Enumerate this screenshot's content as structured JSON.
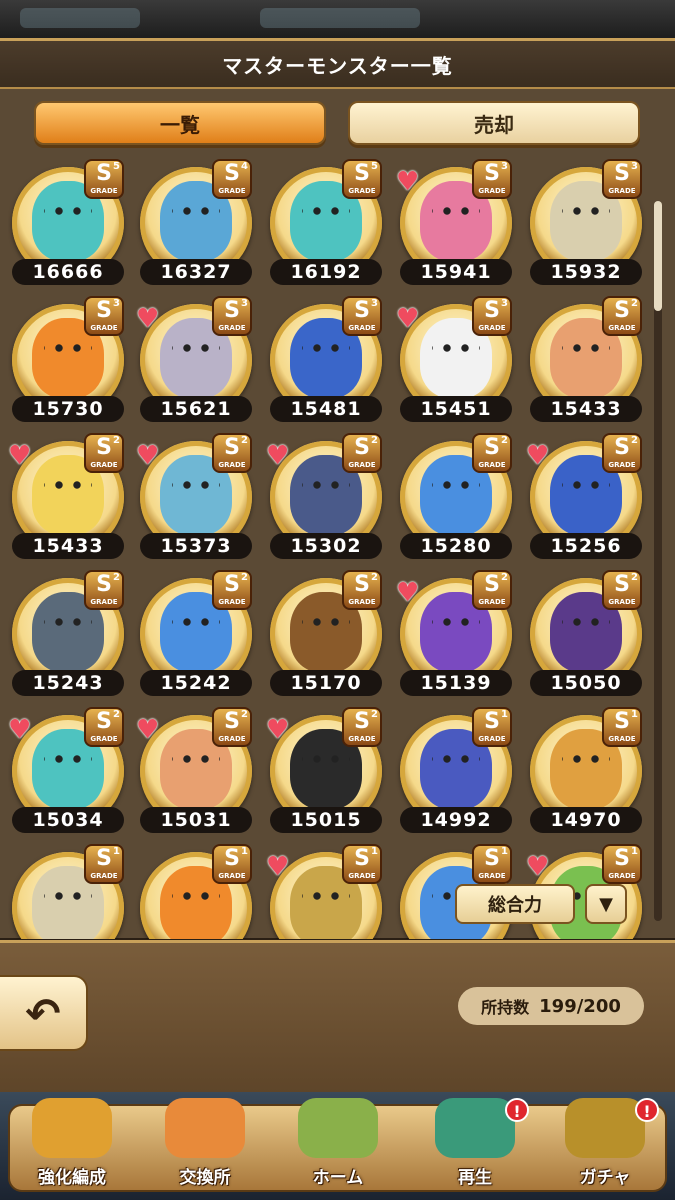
{
  "header": {
    "title": "マスターモンスター一覧"
  },
  "tabs": [
    {
      "label": "一覧",
      "active": true
    },
    {
      "label": "売却",
      "active": false
    }
  ],
  "monsters": [
    {
      "power": "16666",
      "grade": "5",
      "heart": false,
      "color": "#4ec3c0"
    },
    {
      "power": "16327",
      "grade": "4",
      "heart": false,
      "color": "#5aa7d6"
    },
    {
      "power": "16192",
      "grade": "5",
      "heart": false,
      "color": "#4ec3c0"
    },
    {
      "power": "15941",
      "grade": "3",
      "heart": true,
      "color": "#e77a9f"
    },
    {
      "power": "15932",
      "grade": "3",
      "heart": false,
      "color": "#d9cfae"
    },
    {
      "power": "15730",
      "grade": "3",
      "heart": false,
      "color": "#f08a2c"
    },
    {
      "power": "15621",
      "grade": "3",
      "heart": true,
      "color": "#b9b2c8"
    },
    {
      "power": "15481",
      "grade": "3",
      "heart": false,
      "color": "#3a66c9"
    },
    {
      "power": "15451",
      "grade": "3",
      "heart": true,
      "color": "#f2f2f2"
    },
    {
      "power": "15433",
      "grade": "2",
      "heart": false,
      "color": "#e8a070"
    },
    {
      "power": "15433",
      "grade": "2",
      "heart": true,
      "color": "#f2d35a"
    },
    {
      "power": "15373",
      "grade": "2",
      "heart": true,
      "color": "#6fb7d4"
    },
    {
      "power": "15302",
      "grade": "2",
      "heart": true,
      "color": "#4a5a8a"
    },
    {
      "power": "15280",
      "grade": "2",
      "heart": false,
      "color": "#4a8fe0"
    },
    {
      "power": "15256",
      "grade": "2",
      "heart": true,
      "color": "#3a62c8"
    },
    {
      "power": "15243",
      "grade": "2",
      "heart": false,
      "color": "#5a6a7a"
    },
    {
      "power": "15242",
      "grade": "2",
      "heart": false,
      "color": "#4a8fe0"
    },
    {
      "power": "15170",
      "grade": "2",
      "heart": false,
      "color": "#8a5a2a"
    },
    {
      "power": "15139",
      "grade": "2",
      "heart": true,
      "color": "#7a4ac0"
    },
    {
      "power": "15050",
      "grade": "2",
      "heart": false,
      "color": "#5a3a8a"
    },
    {
      "power": "15034",
      "grade": "2",
      "heart": true,
      "color": "#4ec3c0"
    },
    {
      "power": "15031",
      "grade": "2",
      "heart": true,
      "color": "#e8a070"
    },
    {
      "power": "15015",
      "grade": "2",
      "heart": true,
      "color": "#2a2a2a"
    },
    {
      "power": "14992",
      "grade": "1",
      "heart": false,
      "color": "#4a5ac0"
    },
    {
      "power": "14970",
      "grade": "1",
      "heart": false,
      "color": "#e0a040"
    },
    {
      "power": "",
      "grade": "1",
      "heart": false,
      "color": "#d9cfae"
    },
    {
      "power": "",
      "grade": "1",
      "heart": false,
      "color": "#f08a2c"
    },
    {
      "power": "",
      "grade": "1",
      "heart": true,
      "color": "#c9a64a"
    },
    {
      "power": "",
      "grade": "1",
      "heart": false,
      "color": "#4a8fe0"
    },
    {
      "power": "",
      "grade": "1",
      "heart": true,
      "color": "#7ac050"
    }
  ],
  "grade_prefix": "S",
  "grade_word": "GRADE",
  "sort": {
    "label": "総合力",
    "order_icon": "▼"
  },
  "back": {
    "icon": "↶"
  },
  "inventory": {
    "label": "所持数",
    "value": "199/200"
  },
  "nav": [
    {
      "label": "強化編成",
      "icon": "power-up-icon",
      "alert": false,
      "color": "#e0a030"
    },
    {
      "label": "交換所",
      "icon": "shop-icon",
      "alert": false,
      "color": "#e88a3a"
    },
    {
      "label": "ホーム",
      "icon": "home-windmill-icon",
      "alert": false,
      "color": "#8ab04a"
    },
    {
      "label": "再生",
      "icon": "rebirth-crystal-icon",
      "alert": true,
      "color": "#3a9a7a"
    },
    {
      "label": "ガチャ",
      "icon": "gacha-machine-icon",
      "alert": true,
      "color": "#b8902a"
    }
  ],
  "alert_mark": "!"
}
